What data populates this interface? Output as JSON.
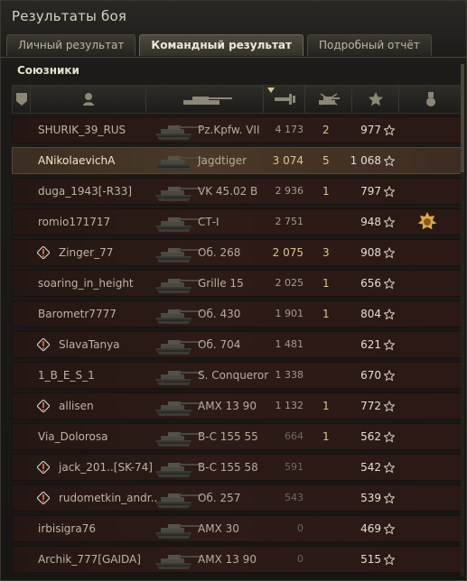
{
  "window": {
    "title": "Результаты боя"
  },
  "tabs": [
    {
      "label": "Личный результат",
      "active": false
    },
    {
      "label": "Командный результат",
      "active": true
    },
    {
      "label": "Подробный отчёт",
      "active": false
    }
  ],
  "section": {
    "title": "Союзники"
  },
  "header_icons": [
    "tier-icon",
    "player-icon",
    "tank-icon",
    "damage-icon",
    "kills-icon",
    "experience-star-icon",
    "medal-icon"
  ],
  "players": [
    {
      "name": "SHURIK_39_RUS",
      "tank": "Pz.Kpfw. VII",
      "damage": "4 173",
      "damage_style": "grey",
      "kills": "2",
      "xp": "977",
      "highlight": false,
      "platoon": false,
      "medal": false
    },
    {
      "name": "ANikolaevichA",
      "tank": "Jagdtiger",
      "damage": "3 074",
      "damage_style": "gold",
      "kills": "5",
      "xp": "1 068",
      "highlight": true,
      "platoon": false,
      "medal": false
    },
    {
      "name": "duga_1943[-R33]",
      "tank": "VK 45.02 B",
      "damage": "2 936",
      "damage_style": "grey",
      "kills": "1",
      "xp": "797",
      "highlight": false,
      "platoon": false,
      "medal": false
    },
    {
      "name": "romio171717",
      "tank": "СТ-I",
      "damage": "2 751",
      "damage_style": "grey",
      "kills": "",
      "xp": "948",
      "highlight": false,
      "platoon": false,
      "medal": true
    },
    {
      "name": "Zinger_77",
      "tank": "Об. 268",
      "damage": "2 075",
      "damage_style": "gold",
      "kills": "3",
      "xp": "908",
      "highlight": false,
      "platoon": true,
      "medal": false
    },
    {
      "name": "soaring_in_height",
      "tank": "Grille 15",
      "damage": "2 025",
      "damage_style": "grey",
      "kills": "1",
      "xp": "656",
      "highlight": false,
      "platoon": false,
      "medal": false
    },
    {
      "name": "Barometr7777",
      "tank": "Об. 430",
      "damage": "1 901",
      "damage_style": "grey",
      "kills": "1",
      "xp": "804",
      "highlight": false,
      "platoon": false,
      "medal": false
    },
    {
      "name": "SlavaTanya",
      "tank": "Об. 704",
      "damage": "1 481",
      "damage_style": "grey",
      "kills": "",
      "xp": "621",
      "highlight": false,
      "platoon": true,
      "medal": false
    },
    {
      "name": "1_B_E_S_1",
      "tank": "S. Conqueror",
      "damage": "1 338",
      "damage_style": "grey",
      "kills": "",
      "xp": "670",
      "highlight": false,
      "platoon": false,
      "medal": false
    },
    {
      "name": "allisen",
      "tank": "AMX 13 90",
      "damage": "1 132",
      "damage_style": "grey",
      "kills": "1",
      "xp": "772",
      "highlight": false,
      "platoon": true,
      "medal": false
    },
    {
      "name": "Via_Dolorosa",
      "tank": "B-C 155 55",
      "damage": "664",
      "damage_style": "dim",
      "kills": "1",
      "xp": "562",
      "highlight": false,
      "platoon": false,
      "medal": false
    },
    {
      "name": "jack_201..[SK-74]",
      "tank": "B-C 155 58",
      "damage": "591",
      "damage_style": "dim",
      "kills": "",
      "xp": "542",
      "highlight": false,
      "platoon": true,
      "medal": false
    },
    {
      "name": "rudometkin_andr..",
      "tank": "Об. 257",
      "damage": "543",
      "damage_style": "dim",
      "kills": "",
      "xp": "539",
      "highlight": false,
      "platoon": true,
      "medal": false
    },
    {
      "name": "irbisigra76",
      "tank": "AMX 30",
      "damage": "0",
      "damage_style": "dim",
      "kills": "",
      "xp": "469",
      "highlight": false,
      "platoon": false,
      "medal": false
    },
    {
      "name": "Archik_777[GAIDA]",
      "tank": "AMX 13 90",
      "damage": "0",
      "damage_style": "dim",
      "kills": "",
      "xp": "515",
      "highlight": false,
      "platoon": false,
      "medal": false
    }
  ],
  "colors": {
    "accent_gold": "#d9c68a",
    "row_bg": "#2c1b16",
    "highlight_bg": "#4a3828"
  }
}
